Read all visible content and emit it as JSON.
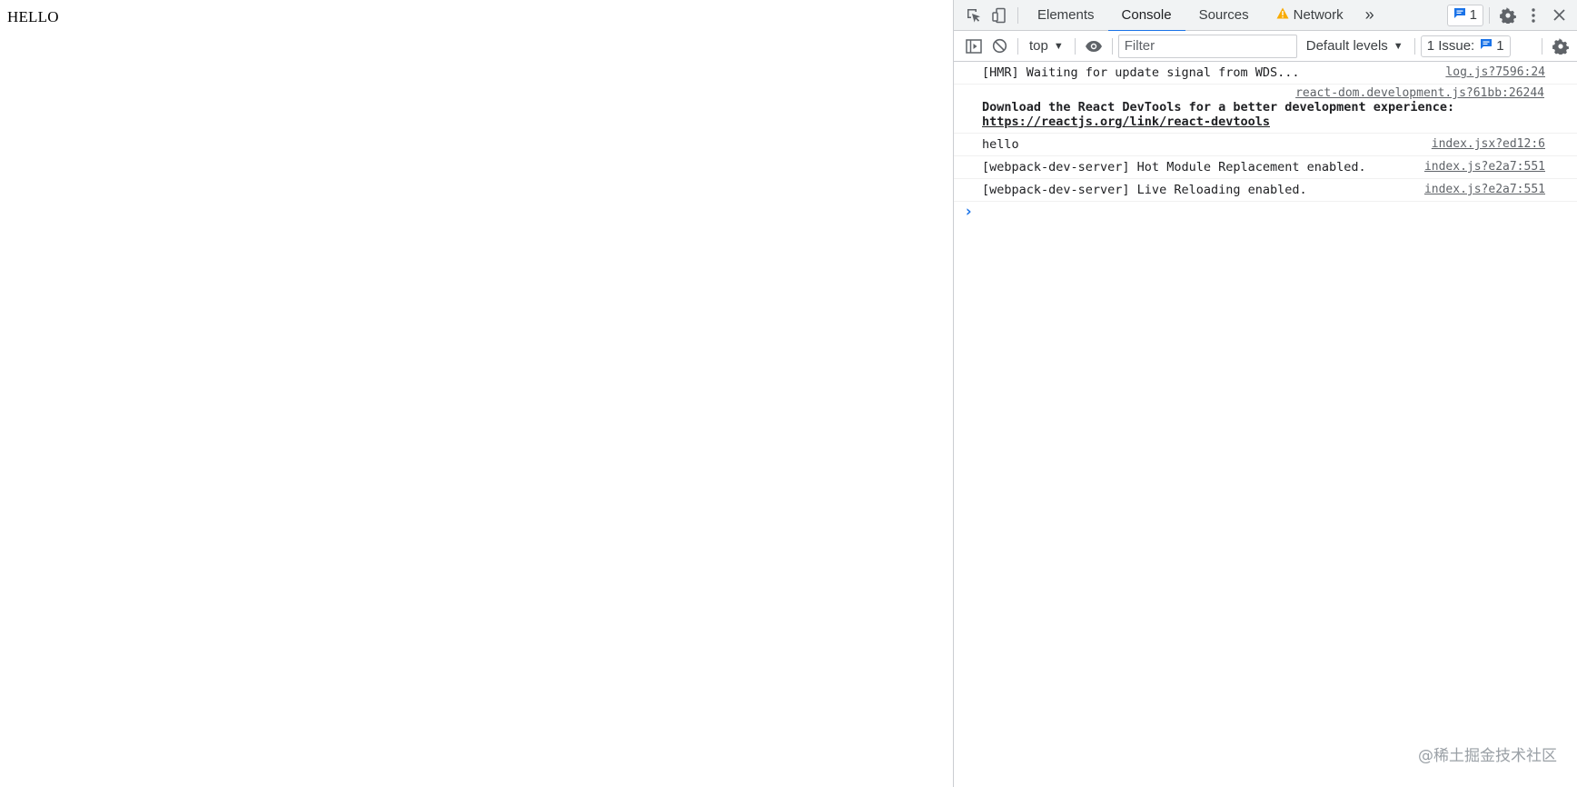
{
  "page": {
    "heading": "HELLO"
  },
  "devtools": {
    "tabs": [
      {
        "label": "Elements"
      },
      {
        "label": "Console"
      },
      {
        "label": "Sources"
      },
      {
        "label": "Network"
      }
    ],
    "more_tabs_glyph": "»",
    "messages_badge_count": "1",
    "console_toolbar": {
      "context": "top",
      "filter_placeholder": "Filter",
      "levels": "Default levels",
      "issues_label": "1 Issue:",
      "issues_count": "1"
    },
    "console_messages": [
      {
        "text": "[HMR] Waiting for update signal from WDS...",
        "source": "log.js?7596:24"
      },
      {
        "text_bold": "Download the React DevTools for a better development experience: ",
        "link": "https://reactjs.org/link/react-devtools",
        "source": "react-dom.development.js?61bb:26244"
      },
      {
        "text": "hello",
        "source": "index.jsx?ed12:6"
      },
      {
        "text": "[webpack-dev-server] Hot Module Replacement enabled.",
        "source": "index.js?e2a7:551"
      },
      {
        "text": "[webpack-dev-server] Live Reloading enabled.",
        "source": "index.js?e2a7:551"
      }
    ],
    "prompt_glyph": "›"
  },
  "watermark": "@稀土掘金技术社区",
  "colors": {
    "accent": "#1a73e8",
    "warning": "#f9ab00"
  }
}
